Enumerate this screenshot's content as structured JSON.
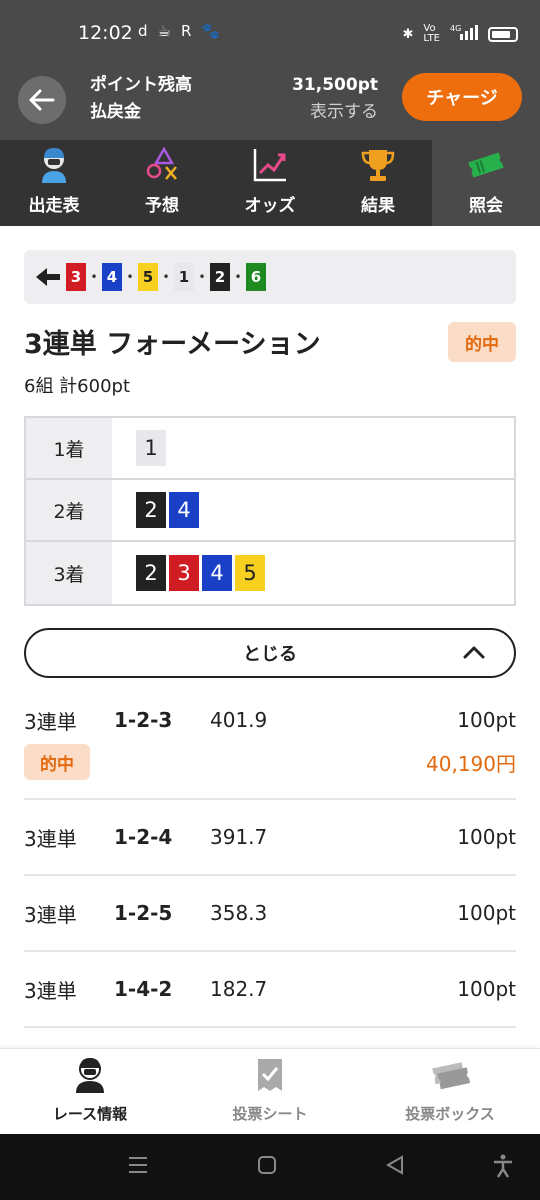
{
  "status_bar": {
    "time": "12:02",
    "left_icons": [
      "d",
      "☕",
      "R",
      "🐾"
    ],
    "network": "4G"
  },
  "header": {
    "points_label": "ポイント残高",
    "refund_label": "払戻金",
    "points_value": "31,500pt",
    "show_label": "表示する",
    "charge_label": "チャージ"
  },
  "tabs": [
    {
      "label": "出走表",
      "icon": "jockey-icon"
    },
    {
      "label": "予想",
      "icon": "symbols-icon"
    },
    {
      "label": "オッズ",
      "icon": "chart-icon"
    },
    {
      "label": "結果",
      "icon": "trophy-icon"
    },
    {
      "label": "照会",
      "icon": "ticket-icon",
      "active": true
    }
  ],
  "result_strip": {
    "order": [
      "3",
      "4",
      "5",
      "1",
      "2",
      "6"
    ]
  },
  "ticket": {
    "title": "3連単 フォーメーション",
    "status": "的中",
    "summary": "6組 計600pt",
    "formation": [
      {
        "label": "1着",
        "nums": [
          "1"
        ]
      },
      {
        "label": "2着",
        "nums": [
          "2",
          "4"
        ]
      },
      {
        "label": "3着",
        "nums": [
          "2",
          "3",
          "4",
          "5"
        ]
      }
    ],
    "close_label": "とじる"
  },
  "bets": [
    {
      "type": "3連単",
      "combo": "1-2-3",
      "odds": "401.9",
      "amount": "100pt",
      "hit": "的中",
      "payout": "40,190円"
    },
    {
      "type": "3連単",
      "combo": "1-2-4",
      "odds": "391.7",
      "amount": "100pt"
    },
    {
      "type": "3連単",
      "combo": "1-2-5",
      "odds": "358.3",
      "amount": "100pt"
    },
    {
      "type": "3連単",
      "combo": "1-4-2",
      "odds": "182.7",
      "amount": "100pt"
    }
  ],
  "bottom_nav": [
    {
      "label": "レース情報",
      "icon": "jockey-icon",
      "active": true
    },
    {
      "label": "投票シート",
      "icon": "check-sheet-icon"
    },
    {
      "label": "投票ボックス",
      "icon": "tickets-icon"
    }
  ],
  "colors": {
    "header_bg": "#4a4a4a",
    "accent": "#ee6e0e",
    "hit_bg": "#fbdcc6",
    "hit_text": "#e46a10"
  }
}
